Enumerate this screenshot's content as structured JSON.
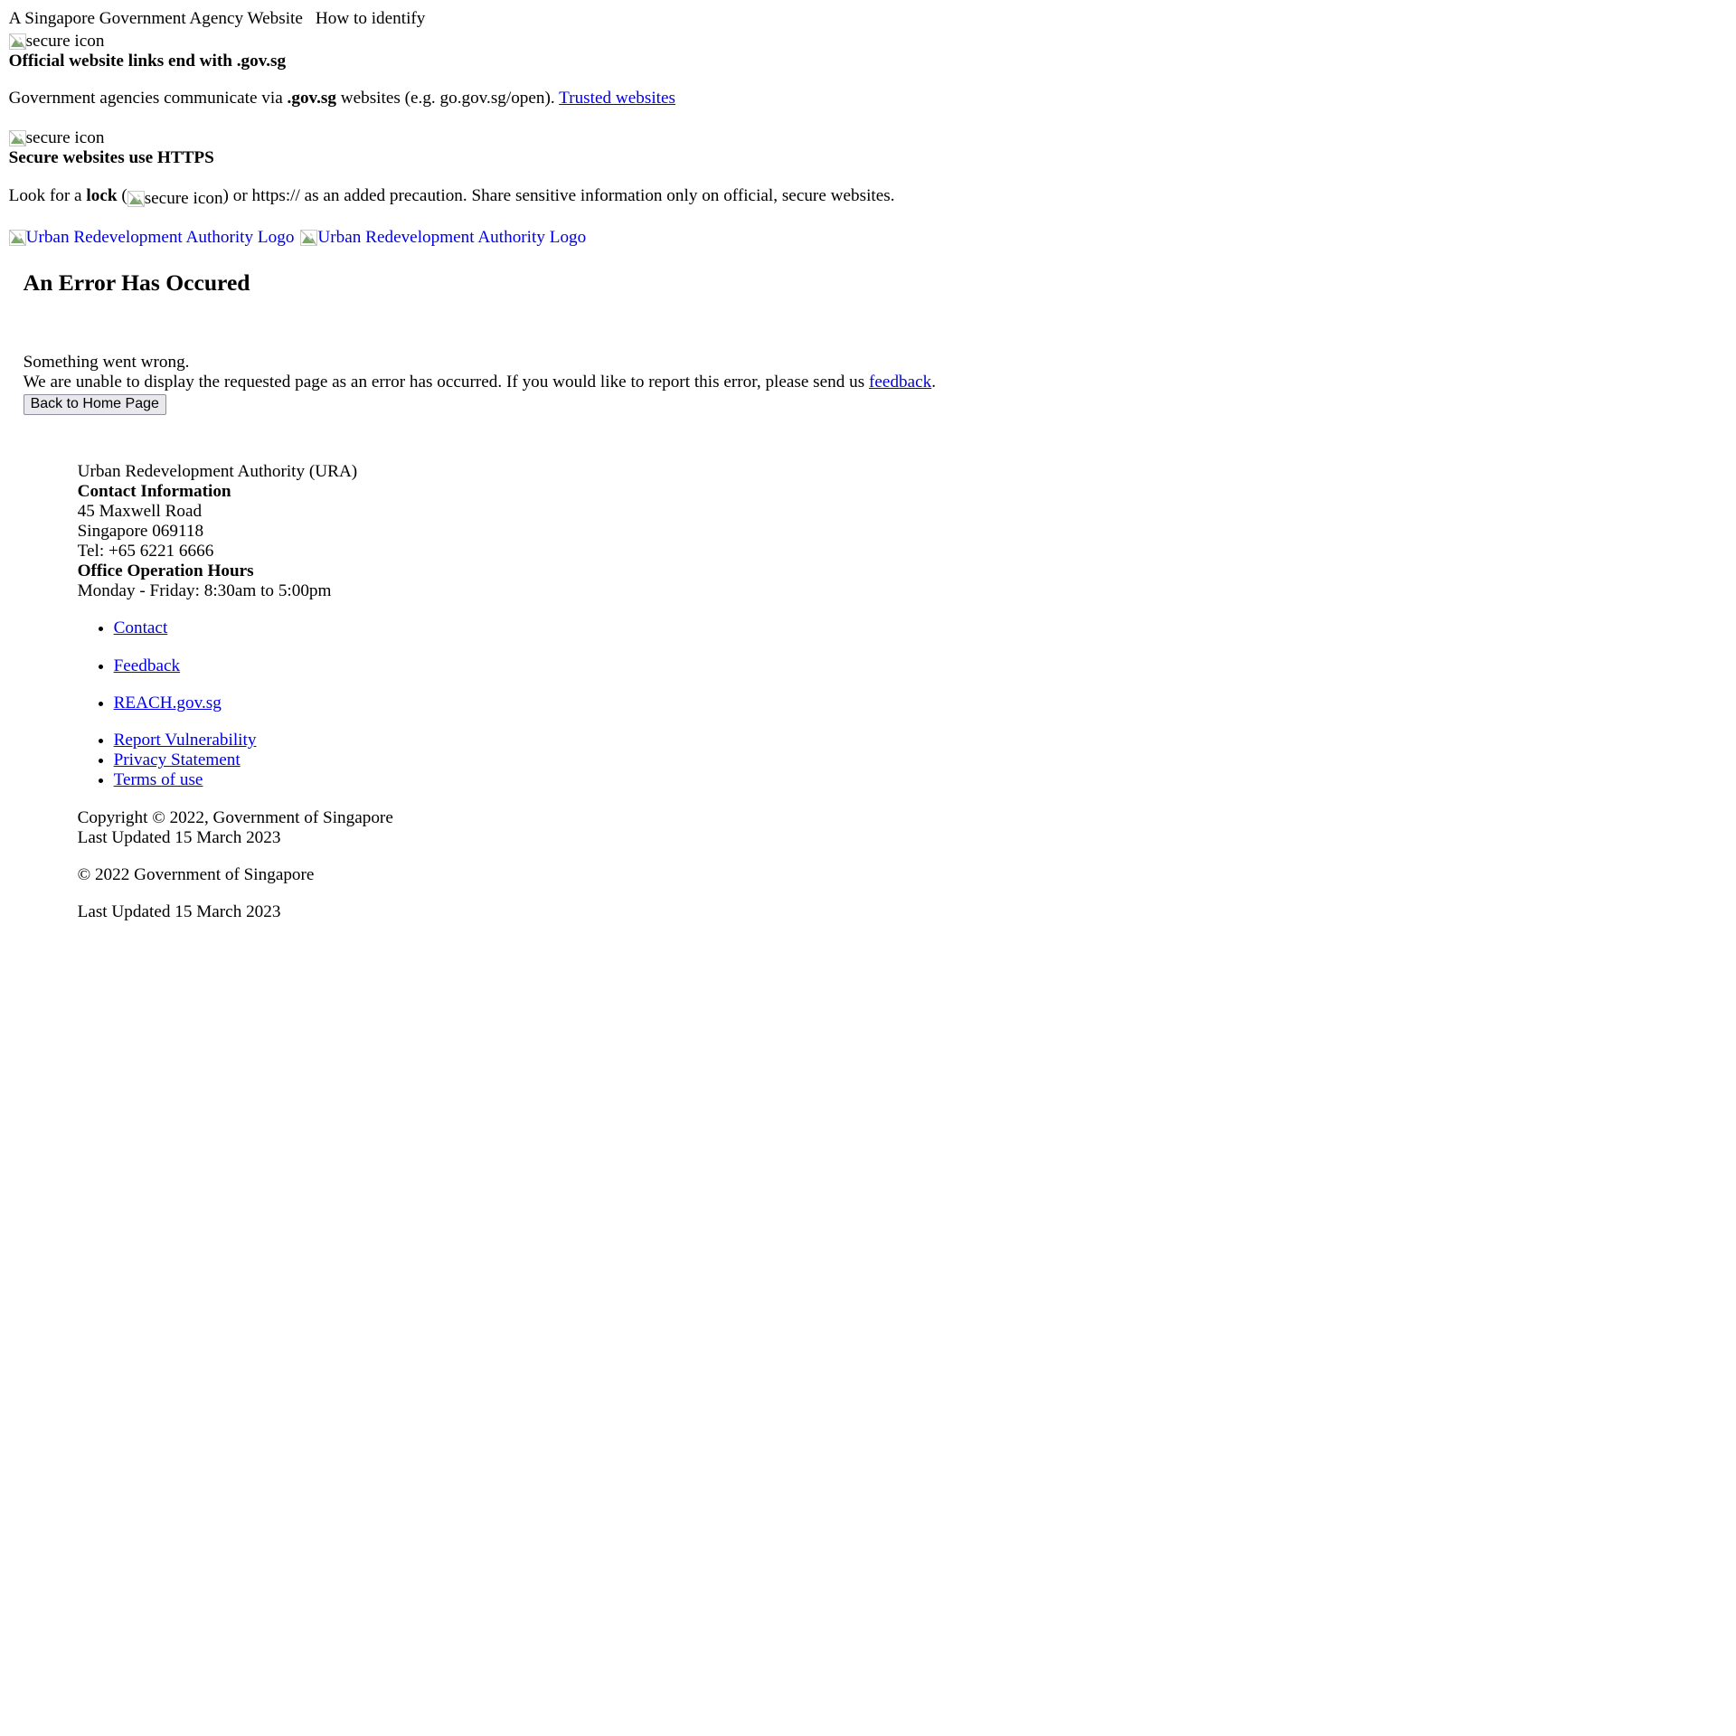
{
  "masthead": {
    "agency_text": "A Singapore Government Agency Website",
    "how_to_identify": "How to identify",
    "blocks": [
      {
        "icon_alt": "secure icon",
        "heading": "Official website links end with .gov.sg",
        "body_before": "Government agencies communicate via ",
        "body_bold": ".gov.sg",
        "body_after": " websites (e.g. go.gov.sg/open). ",
        "link_label": "Trusted websites"
      },
      {
        "icon_alt": "secure icon",
        "heading": "Secure websites use HTTPS",
        "body_before": "Look for a ",
        "body_bold": "lock",
        "body_mid": " (",
        "inline_icon_alt": "secure icon",
        "body_after": ") or https:// as an added precaution. Share sensitive information only on official, secure websites."
      }
    ]
  },
  "header": {
    "logo_alt_1": "Urban Redevelopment Authority Logo",
    "logo_alt_2": "Urban Redevelopment Authority Logo"
  },
  "error": {
    "title": "An Error Has Occured",
    "line1": "Something went wrong.",
    "line2_before": "We are unable to display the requested page as an error has occurred. If you would like to report this error, please send us ",
    "line2_link": "feedback",
    "line2_after": ".",
    "button_label": "Back to Home Page"
  },
  "footer": {
    "org_name": "Urban Redevelopment Authority (URA)",
    "contact_heading": "Contact Information",
    "address_line1": "45 Maxwell Road",
    "address_line2": "Singapore 069118",
    "telephone": "Tel: +65 6221 6666",
    "hours_heading": "Office Operation Hours",
    "hours_value": "Monday - Friday: 8:30am to 5:00pm",
    "links": [
      {
        "label": "Contact",
        "spaced": true
      },
      {
        "label": "Feedback",
        "spaced": true
      },
      {
        "label": "REACH.gov.sg",
        "spaced": true
      },
      {
        "label": "Report Vulnerability",
        "spaced": false
      },
      {
        "label": "Privacy Statement",
        "spaced": false
      },
      {
        "label": "Terms of use",
        "spaced": false
      }
    ],
    "copyright_line": "Copyright © 2022, Government of Singapore",
    "last_updated_line": "Last Updated 15 March 2023",
    "copyright_single": "© 2022 Government of Singapore",
    "last_updated_single": "Last Updated 15 March 2023"
  },
  "colors": {
    "link": "#0000EE",
    "link_visited": "#551A8B",
    "text": "#000000",
    "background": "#FFFFFF",
    "button_face": "#E9E9ED",
    "button_border": "#8F8F9D"
  }
}
